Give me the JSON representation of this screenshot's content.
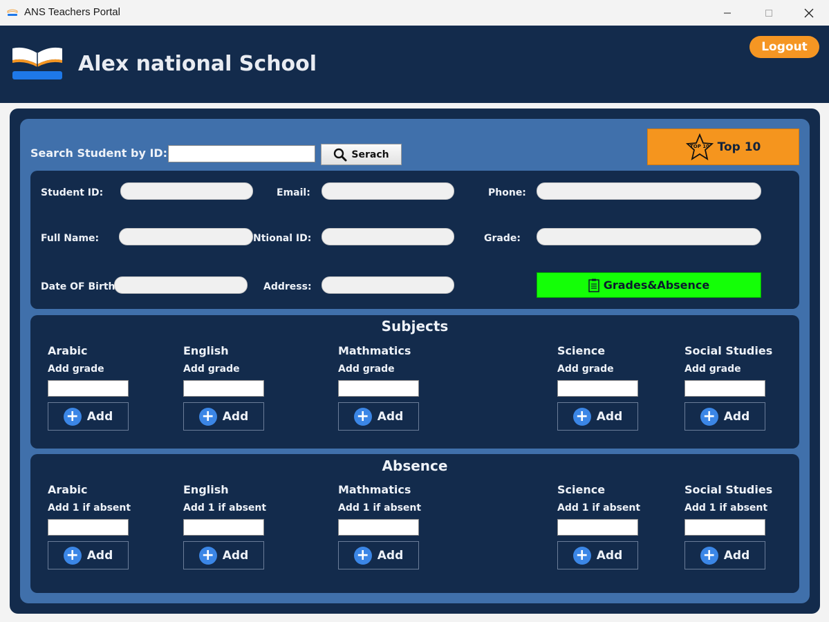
{
  "window": {
    "title": "ANS Teachers Portal"
  },
  "header": {
    "school_name": "Alex national School",
    "logout_label": "Logout",
    "logo_icon": "open-book-logo",
    "accent": "#f59623",
    "bg": "#132b4c"
  },
  "search": {
    "label": "Search Student by ID:",
    "value": "",
    "button_label": "Serach"
  },
  "top10": {
    "label": "Top 10",
    "icon_text": "TOP 10"
  },
  "info": {
    "student_id": "Student ID:",
    "email": "Email:",
    "phone": "Phone:",
    "full_name": "Full Name:",
    "national_id": "Ntional ID:",
    "grade": "Grade:",
    "dob": "Date OF Birth:",
    "address": "Address:",
    "grades_absence_label": "Grades&Absence"
  },
  "subjects_panel": {
    "title": "Subjects",
    "items": [
      {
        "name": "Arabic",
        "hint": "Add grade",
        "add": "Add"
      },
      {
        "name": "English",
        "hint": "Add grade",
        "add": "Add"
      },
      {
        "name": "Mathmatics",
        "hint": "Add grade",
        "add": "Add"
      },
      {
        "name": "Science",
        "hint": "Add grade",
        "add": "Add"
      },
      {
        "name": "Social Studies",
        "hint": "Add grade",
        "add": "Add"
      }
    ]
  },
  "absence_panel": {
    "title": "Absence",
    "items": [
      {
        "name": "Arabic",
        "hint": "Add 1 if absent",
        "add": "Add"
      },
      {
        "name": "English",
        "hint": "Add 1 if absent",
        "add": "Add"
      },
      {
        "name": "Mathmatics",
        "hint": "Add 1 if absent",
        "add": "Add"
      },
      {
        "name": "Science",
        "hint": "Add 1 if absent",
        "add": "Add"
      },
      {
        "name": "Social Studies",
        "hint": "Add 1 if absent",
        "add": "Add"
      }
    ]
  }
}
